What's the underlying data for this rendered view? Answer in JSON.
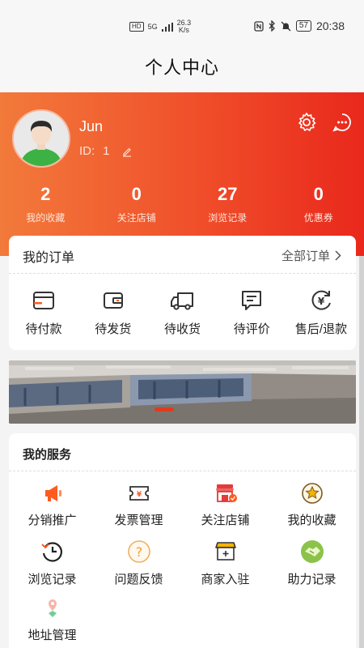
{
  "status_bar": {
    "hd": "HD",
    "net": "5G",
    "speed_value": "26.3",
    "speed_unit": "K/s",
    "battery": "57",
    "time": "20:38"
  },
  "header": {
    "title": "个人中心"
  },
  "profile": {
    "name": "Jun",
    "id_label": "ID:",
    "id_value": "1"
  },
  "stats": [
    {
      "value": "2",
      "label": "我的收藏"
    },
    {
      "value": "0",
      "label": "关注店铺"
    },
    {
      "value": "27",
      "label": "浏览记录"
    },
    {
      "value": "0",
      "label": "优惠券"
    }
  ],
  "orders": {
    "title": "我的订单",
    "all_label": "全部订单",
    "items": [
      {
        "label": "待付款",
        "icon": "card-icon"
      },
      {
        "label": "待发货",
        "icon": "wallet-icon"
      },
      {
        "label": "待收货",
        "icon": "truck-icon"
      },
      {
        "label": "待评价",
        "icon": "comment-icon"
      },
      {
        "label": "售后/退款",
        "icon": "refund-icon"
      }
    ]
  },
  "services": {
    "title": "我的服务",
    "items": [
      {
        "label": "分销推广",
        "icon": "megaphone-icon"
      },
      {
        "label": "发票管理",
        "icon": "invoice-icon"
      },
      {
        "label": "关注店铺",
        "icon": "shop-icon"
      },
      {
        "label": "我的收藏",
        "icon": "star-icon"
      },
      {
        "label": "浏览记录",
        "icon": "history-icon"
      },
      {
        "label": "问题反馈",
        "icon": "question-icon"
      },
      {
        "label": "商家入驻",
        "icon": "merchant-icon"
      },
      {
        "label": "助力记录",
        "icon": "handshake-icon"
      },
      {
        "label": "地址管理",
        "icon": "location-icon"
      }
    ]
  },
  "colors": {
    "hero_start": "#f27a3b",
    "hero_end": "#e9281c",
    "accent": "#ff5a1f"
  }
}
